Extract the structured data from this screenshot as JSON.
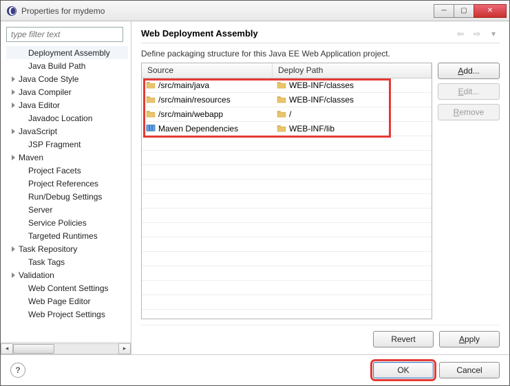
{
  "title": "Properties for mydemo",
  "filter_placeholder": "type filter text",
  "tree": [
    {
      "label": "Deployment Assembly",
      "expandable": false,
      "selected": true,
      "indent": true
    },
    {
      "label": "Java Build Path",
      "expandable": false,
      "indent": true
    },
    {
      "label": "Java Code Style",
      "expandable": true
    },
    {
      "label": "Java Compiler",
      "expandable": true
    },
    {
      "label": "Java Editor",
      "expandable": true
    },
    {
      "label": "Javadoc Location",
      "expandable": false,
      "indent": true
    },
    {
      "label": "JavaScript",
      "expandable": true
    },
    {
      "label": "JSP Fragment",
      "expandable": false,
      "indent": true
    },
    {
      "label": "Maven",
      "expandable": true
    },
    {
      "label": "Project Facets",
      "expandable": false,
      "indent": true
    },
    {
      "label": "Project References",
      "expandable": false,
      "indent": true
    },
    {
      "label": "Run/Debug Settings",
      "expandable": false,
      "indent": true
    },
    {
      "label": "Server",
      "expandable": false,
      "indent": true
    },
    {
      "label": "Service Policies",
      "expandable": false,
      "indent": true
    },
    {
      "label": "Targeted Runtimes",
      "expandable": false,
      "indent": true
    },
    {
      "label": "Task Repository",
      "expandable": true
    },
    {
      "label": "Task Tags",
      "expandable": false,
      "indent": true
    },
    {
      "label": "Validation",
      "expandable": true
    },
    {
      "label": "Web Content Settings",
      "expandable": false,
      "indent": true
    },
    {
      "label": "Web Page Editor",
      "expandable": false,
      "indent": true
    },
    {
      "label": "Web Project Settings",
      "expandable": false,
      "indent": true
    }
  ],
  "page": {
    "title": "Web Deployment Assembly",
    "desc": "Define packaging structure for this Java EE Web Application project.",
    "columns": {
      "source": "Source",
      "deploy": "Deploy Path"
    },
    "rows": [
      {
        "source": "/src/main/java",
        "deploy": "WEB-INF/classes",
        "icon": "folder"
      },
      {
        "source": "/src/main/resources",
        "deploy": "WEB-INF/classes",
        "icon": "folder"
      },
      {
        "source": "/src/main/webapp",
        "deploy": "/",
        "icon": "folder"
      },
      {
        "source": "Maven Dependencies",
        "deploy": "WEB-INF/lib",
        "icon": "lib"
      }
    ]
  },
  "buttons": {
    "add": "Add...",
    "edit": "Edit...",
    "remove": "Remove",
    "revert": "Revert",
    "apply": "Apply",
    "ok": "OK",
    "cancel": "Cancel"
  }
}
